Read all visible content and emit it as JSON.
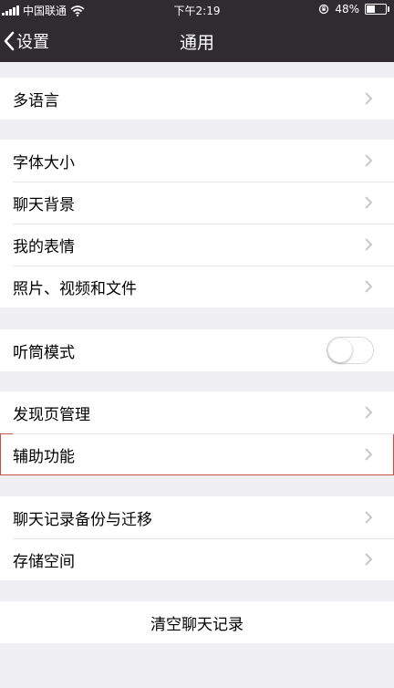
{
  "status_bar": {
    "carrier": "中国联通",
    "time": "下午2:19",
    "battery": "48%",
    "battery_level": 0.48
  },
  "nav": {
    "back_label": "设置",
    "title": "通用"
  },
  "groups": [
    {
      "items": [
        {
          "label": "多语言"
        }
      ]
    },
    {
      "items": [
        {
          "label": "字体大小"
        },
        {
          "label": "聊天背景"
        },
        {
          "label": "我的表情"
        },
        {
          "label": "照片、视频和文件"
        }
      ]
    },
    {
      "items": [
        {
          "label": "听筒模式",
          "toggle": false
        }
      ]
    },
    {
      "items": [
        {
          "label": "发现页管理"
        },
        {
          "label": "辅助功能"
        }
      ]
    },
    {
      "items": [
        {
          "label": "聊天记录备份与迁移"
        },
        {
          "label": "存储空间"
        }
      ]
    }
  ],
  "clear_button": {
    "label": "清空聊天记录"
  },
  "colors": {
    "nav_background": "#2e2c31",
    "page_background": "#efeff4",
    "selection_outline": "#c9504a"
  }
}
